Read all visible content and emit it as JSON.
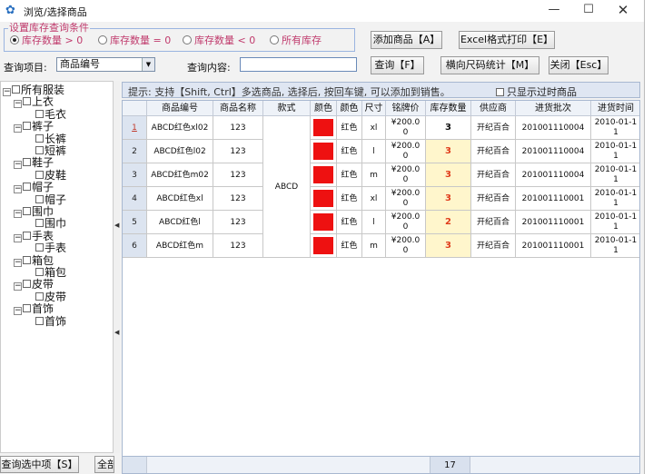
{
  "window": {
    "title": "浏览/选择商品",
    "minimize": "—",
    "maximize": "☐",
    "close": "✕"
  },
  "stock_filter": {
    "legend": "设置库存查询条件",
    "options": [
      {
        "label": "库存数量 > 0",
        "selected": true
      },
      {
        "label": "库存数量 = 0",
        "selected": false
      },
      {
        "label": "库存数量 < 0",
        "selected": false
      },
      {
        "label": "所有库存",
        "selected": false
      }
    ]
  },
  "toolbar": {
    "add_label": "添加商品【A】",
    "excel_label": "Excel格式打印【E】",
    "query_label": "查询【F】",
    "stat_label": "横向尺码统计【M】",
    "close_label": "关闭【Esc】"
  },
  "query": {
    "field_label": "查询项目:",
    "field_value": "商品编号",
    "content_label": "查询内容:",
    "content_value": ""
  },
  "tree": {
    "nodes": [
      {
        "label": "所有服装",
        "level": 0,
        "expander": "⊟"
      },
      {
        "label": "上衣",
        "level": 1,
        "expander": "⊟"
      },
      {
        "label": "毛衣",
        "level": 2,
        "expander": ""
      },
      {
        "label": "裤子",
        "level": 1,
        "expander": "⊟"
      },
      {
        "label": "长裤",
        "level": 2,
        "expander": ""
      },
      {
        "label": "短裤",
        "level": 2,
        "expander": ""
      },
      {
        "label": "鞋子",
        "level": 1,
        "expander": "⊟"
      },
      {
        "label": "皮鞋",
        "level": 2,
        "expander": ""
      },
      {
        "label": "帽子",
        "level": 1,
        "expander": "⊟"
      },
      {
        "label": "帽子",
        "level": 2,
        "expander": ""
      },
      {
        "label": "围巾",
        "level": 1,
        "expander": "⊟"
      },
      {
        "label": "围巾",
        "level": 2,
        "expander": ""
      },
      {
        "label": "手表",
        "level": 1,
        "expander": "⊟"
      },
      {
        "label": "手表",
        "level": 2,
        "expander": ""
      },
      {
        "label": "箱包",
        "level": 1,
        "expander": "⊟"
      },
      {
        "label": "箱包",
        "level": 2,
        "expander": ""
      },
      {
        "label": "皮带",
        "level": 1,
        "expander": "⊟"
      },
      {
        "label": "皮带",
        "level": 2,
        "expander": ""
      },
      {
        "label": "首饰",
        "level": 1,
        "expander": "⊟"
      },
      {
        "label": "首饰",
        "level": 2,
        "expander": ""
      }
    ],
    "query_selected_label": "查询选中项【S】",
    "all_label": "全部"
  },
  "tip": {
    "text": "提示: 支持【Shift, Ctrl】多选商品, 选择后, 按回车键, 可以添加到销售。",
    "only_expired_label": "只显示过时商品"
  },
  "table": {
    "headers": [
      "",
      "商品编号",
      "商品名称",
      "款式",
      "颜色",
      "颜色",
      "尺寸",
      "铭牌价",
      "库存数量",
      "供应商",
      "进货批次",
      "进货时间"
    ],
    "style_merged": "ABCD",
    "swatch_color": "#ee1111",
    "stock_highlight_color": "#fff6cc",
    "rows": [
      {
        "idx": "1",
        "code": "ABCD红色xl02",
        "name": "123",
        "color": "红色",
        "size": "xl",
        "price": "¥200.0\n0",
        "stock": "3",
        "stock_color": "#111111",
        "supplier": "开纪百合",
        "batch": "201001110004",
        "time": "2010-01-1\n1"
      },
      {
        "idx": "2",
        "code": "ABCD红色l02",
        "name": "123",
        "color": "红色",
        "size": "l",
        "price": "¥200.0\n0",
        "stock": "3",
        "stock_color": "#e03c1c",
        "supplier": "开纪百合",
        "batch": "201001110004",
        "time": "2010-01-1\n1"
      },
      {
        "idx": "3",
        "code": "ABCD红色m02",
        "name": "123",
        "color": "红色",
        "size": "m",
        "price": "¥200.0\n0",
        "stock": "3",
        "stock_color": "#e03c1c",
        "supplier": "开纪百合",
        "batch": "201001110004",
        "time": "2010-01-1\n1"
      },
      {
        "idx": "4",
        "code": "ABCD红色xl",
        "name": "123",
        "color": "红色",
        "size": "xl",
        "price": "¥200.0\n0",
        "stock": "3",
        "stock_color": "#e03c1c",
        "supplier": "开纪百合",
        "batch": "201001110001",
        "time": "2010-01-1\n1"
      },
      {
        "idx": "5",
        "code": "ABCD红色l",
        "name": "123",
        "color": "红色",
        "size": "l",
        "price": "¥200.0\n0",
        "stock": "2",
        "stock_color": "#e03c1c",
        "supplier": "开纪百合",
        "batch": "201001110001",
        "time": "2010-01-1\n1"
      },
      {
        "idx": "6",
        "code": "ABCD红色m",
        "name": "123",
        "color": "红色",
        "size": "m",
        "price": "¥200.0\n0",
        "stock": "3",
        "stock_color": "#e03c1c",
        "supplier": "开纪百合",
        "batch": "201001110001",
        "time": "2010-01-1\n1"
      }
    ],
    "total_stock": "17"
  }
}
